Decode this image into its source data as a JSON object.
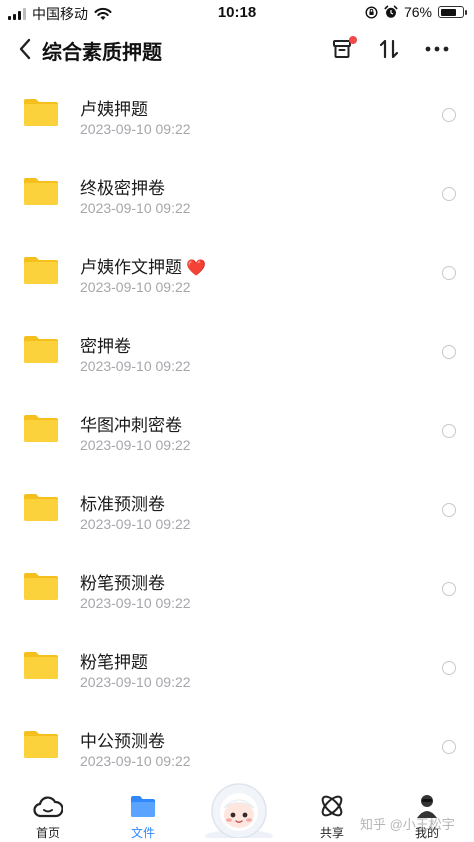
{
  "status_bar": {
    "carrier": "中国移动",
    "time": "10:18",
    "battery_text": "76%",
    "battery_level": 0.76
  },
  "nav": {
    "title": "综合素质押题",
    "archive_icon": "archive-box-icon",
    "sort_icon": "sort-arrows-icon",
    "more_icon": "more-dots-icon"
  },
  "files": [
    {
      "name": "卢姨押题",
      "date": "2023-09-10 09:22"
    },
    {
      "name": "终极密押卷",
      "date": "2023-09-10 09:22"
    },
    {
      "name": "卢姨作文押题",
      "date": "2023-09-10 09:22",
      "emoji": "❤️"
    },
    {
      "name": "密押卷",
      "date": "2023-09-10 09:22"
    },
    {
      "name": "华图冲刺密卷",
      "date": "2023-09-10 09:22"
    },
    {
      "name": "标准预测卷",
      "date": "2023-09-10 09:22"
    },
    {
      "name": "粉笔预测卷",
      "date": "2023-09-10 09:22"
    },
    {
      "name": "粉笔押题",
      "date": "2023-09-10 09:22"
    },
    {
      "name": "中公预测卷",
      "date": "2023-09-10 09:22"
    }
  ],
  "tabs": {
    "home": "首页",
    "files": "文件",
    "share": "共享",
    "me": "我的"
  },
  "colors": {
    "accent": "#2f89fc",
    "folder": "#fbd13c",
    "folder_dark": "#f5bf1e",
    "date": "#a5a7ab",
    "badge": "#f04a4a"
  },
  "watermark": "知乎 @小王松宇"
}
